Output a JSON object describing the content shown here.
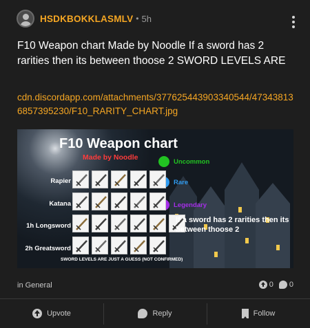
{
  "post": {
    "username": "HSDKBOKKLASMLV",
    "separator": "•",
    "time_ago": "5h",
    "title": "F10 Weapon chart Made by Noodle If a sword has 2 rarities then its between thoose 2 SWORD LEVELS ARE",
    "link": "cdn.discordapp.com/attachments/377625443903340544/473438136857395230/F10_RARITY_CHART.jpg",
    "category": "in General",
    "upvotes": "0",
    "replies": "0"
  },
  "image": {
    "title": "F10 Weapon chart",
    "subtitle": "Made by Noodle",
    "legend": [
      {
        "label": "Uncommon",
        "color": "#22c322"
      },
      {
        "label": "Rare",
        "color": "#2f9bf0"
      },
      {
        "label": "Legendary",
        "color": "#a52ee8"
      }
    ],
    "rows": [
      "Rapier",
      "Katana",
      "1h Longsword",
      "2h Greatsword"
    ],
    "note": "If a sword has 2 rarities then its between thoose 2",
    "footer": "SWORD LEVELS ARE JUST A GUESS (NOT CONFIRMED)",
    "accent_colors": {
      "uncommon": "#22c322",
      "rare": "#2f9bf0",
      "legendary": "#a52ee8"
    }
  },
  "actions": {
    "upvote": "Upvote",
    "reply": "Reply",
    "follow": "Follow"
  },
  "icons": {
    "avatar": "user-avatar-icon",
    "menu": "more-vertical-icon",
    "upvote": "upvote-arrow-icon",
    "reply": "speech-bubble-icon",
    "follow": "bookmark-icon"
  }
}
